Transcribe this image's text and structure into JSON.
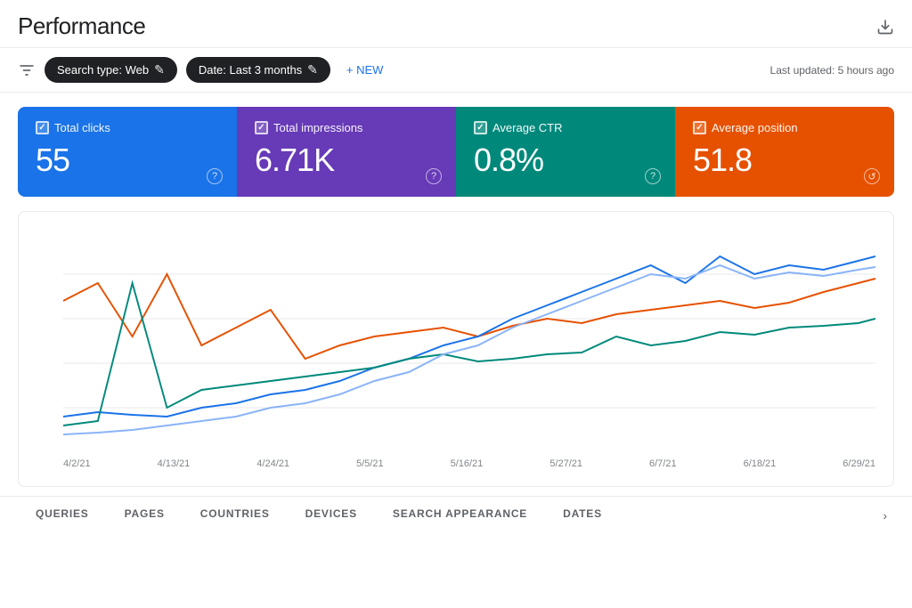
{
  "header": {
    "title": "Performance",
    "last_updated": "Last updated: 5 hours ago"
  },
  "toolbar": {
    "filter_icon": "≡",
    "chips": [
      {
        "label": "Search type: Web",
        "icon": "✎"
      },
      {
        "label": "Date: Last 3 months",
        "icon": "✎"
      }
    ],
    "new_button": "+ NEW"
  },
  "metrics": [
    {
      "label": "Total clicks",
      "value": "55",
      "color": "blue",
      "checked": true
    },
    {
      "label": "Total impressions",
      "value": "6.71K",
      "color": "purple",
      "checked": true
    },
    {
      "label": "Average CTR",
      "value": "0.8%",
      "color": "teal",
      "checked": true
    },
    {
      "label": "Average position",
      "value": "51.8",
      "color": "orange",
      "checked": true
    }
  ],
  "chart": {
    "dates": [
      "4/2/21",
      "4/13/21",
      "4/24/21",
      "5/5/21",
      "5/16/21",
      "5/27/21",
      "6/7/21",
      "6/18/21",
      "6/29/21"
    ]
  },
  "tabs": [
    {
      "label": "QUERIES",
      "active": false
    },
    {
      "label": "PAGES",
      "active": false
    },
    {
      "label": "COUNTRIES",
      "active": false
    },
    {
      "label": "DEVICES",
      "active": false
    },
    {
      "label": "SEARCH APPEARANCE",
      "active": false
    },
    {
      "label": "DATES",
      "active": false
    }
  ]
}
